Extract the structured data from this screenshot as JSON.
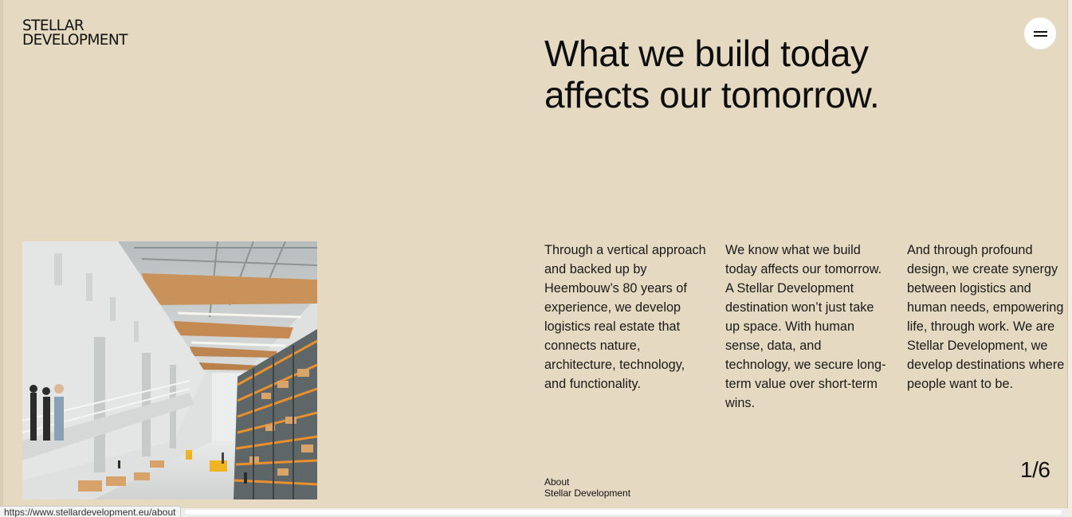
{
  "brand": {
    "logo_line1": "STELLAR",
    "logo_line2": "DEVELOPMENT"
  },
  "hero": {
    "headline_line1": "What we build today",
    "headline_line2": "affects our tomorrow."
  },
  "menu": {
    "icon": "hamburger-icon",
    "label": "Menu"
  },
  "image": {
    "alt": "Warehouse interior with orange storage racks and people on a mezzanine"
  },
  "columns": [
    "Through a vertical approach and backed up by Heembouw’s 80 years of experience, we develop logistics real estate that connects nature, architecture, technology, and functionality.",
    "We know what we build today affects our tomorrow. A Stellar Development destination won’t just take up space. With human sense, data, and technology, we secure long-term value over short-term wins.",
    "And through profound design, we create synergy between logistics and human needs, empowering life, through work. We are Stellar Development, we develop destinations where people want to be."
  ],
  "section": {
    "label_line1": "About",
    "label_line2": "Stellar Development"
  },
  "slider": {
    "counter": "1/6",
    "current": 1,
    "total": 6
  },
  "status_bar": {
    "url": "https://www.stellardevelopment.eu/about"
  },
  "colors": {
    "background": "#e6d9c1",
    "text": "#111111",
    "rack_orange": "#e8902e",
    "button_bg": "#ffffff"
  }
}
